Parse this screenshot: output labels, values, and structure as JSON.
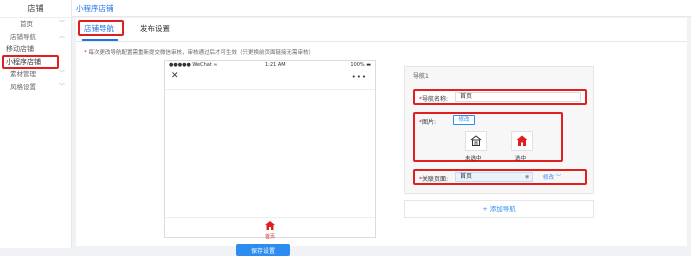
{
  "sidebar": {
    "title": "店铺",
    "items": [
      {
        "label": "首页",
        "chev": "﹀"
      },
      {
        "label": "店铺导航",
        "chev": "︿"
      },
      {
        "label": "移动店铺"
      },
      {
        "label": "小程序店铺"
      },
      {
        "label": "素材管理",
        "chev": "﹀"
      },
      {
        "label": "风格设置",
        "chev": "﹀"
      }
    ]
  },
  "topbar": {
    "breadcrumb": "小程序店铺"
  },
  "tabs": [
    {
      "label": "店铺导航"
    },
    {
      "label": "发布设置"
    }
  ],
  "notice": {
    "star": "*",
    "text": "每次更改导航配置需重新提交微信审核，审核通过后才可生效（只更换前页面链接无需审核）"
  },
  "phone": {
    "status_left": "●●●●● WeChat ≈",
    "status_time": "1:21 AM",
    "status_right": "100% ▬",
    "close_glyph": "✕",
    "more_glyph": "•••",
    "tabbar_label": "首页"
  },
  "panel": {
    "title": "导航1",
    "required_mark": "*",
    "name_label": "导航名称:",
    "name_value": "首页",
    "image_label": "图片:",
    "modify_label": "修改",
    "unselected_caption": "未选中",
    "selected_caption": "选中",
    "page_label": "关联页面:",
    "page_value": "首页",
    "eye_glyph": "◉",
    "page_modify": "修改 ﹀"
  },
  "add_nav": {
    "label": "+ 添加导航"
  },
  "save_button": {
    "label": "保存设置"
  },
  "colors": {
    "accent": "#2d8cf0",
    "highlight": "#e02020",
    "home_icon_active": "#e02020"
  }
}
